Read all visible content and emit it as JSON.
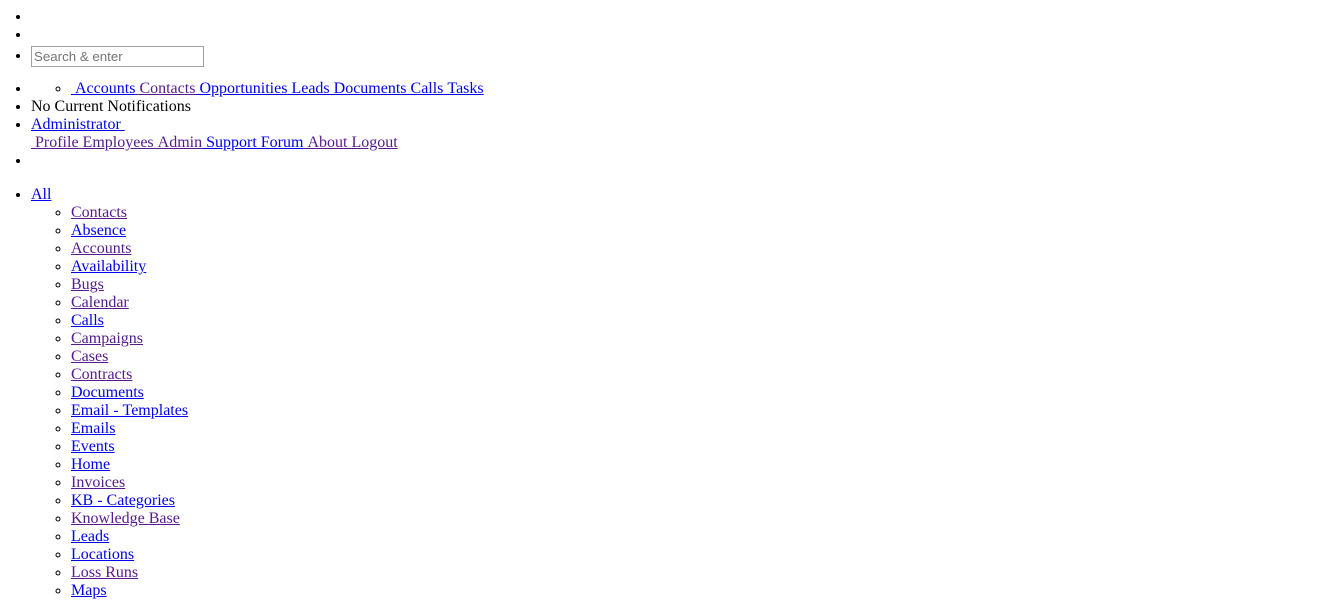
{
  "search": {
    "placeholder": "Search & enter",
    "value": ""
  },
  "quick_create": [
    {
      "label": " Accounts",
      "visited": false
    },
    {
      "label": " Contacts",
      "visited": true
    },
    {
      "label": " Opportunities",
      "visited": false
    },
    {
      "label": " Leads",
      "visited": false
    },
    {
      "label": " Documents",
      "visited": false
    },
    {
      "label": " Calls",
      "visited": false
    },
    {
      "label": " Tasks",
      "visited": false
    }
  ],
  "notifications": {
    "text": "No Current Notifications"
  },
  "user_menu": {
    "username": "Administrator ",
    "items": [
      {
        "label": " Profile",
        "visited": true
      },
      {
        "label": " Employees",
        "visited": true
      },
      {
        "label": " Admin",
        "visited": true
      },
      {
        "label": " Support Forum",
        "visited": false
      },
      {
        "label": " About",
        "visited": true
      },
      {
        "label": " Logout",
        "visited": true
      }
    ]
  },
  "modules": {
    "all_label": "All",
    "items": [
      {
        "label": "Contacts",
        "visited": true
      },
      {
        "label": "Absence",
        "visited": false
      },
      {
        "label": "Accounts",
        "visited": true
      },
      {
        "label": "Availability",
        "visited": false
      },
      {
        "label": "Bugs",
        "visited": true
      },
      {
        "label": "Calendar",
        "visited": true
      },
      {
        "label": "Calls",
        "visited": false
      },
      {
        "label": "Campaigns",
        "visited": true
      },
      {
        "label": "Cases",
        "visited": true
      },
      {
        "label": "Contracts",
        "visited": true
      },
      {
        "label": "Documents",
        "visited": false
      },
      {
        "label": "Email - Templates",
        "visited": false
      },
      {
        "label": "Emails",
        "visited": false
      },
      {
        "label": "Events",
        "visited": false
      },
      {
        "label": "Home",
        "visited": false
      },
      {
        "label": "Invoices",
        "visited": true
      },
      {
        "label": "KB - Categories",
        "visited": false
      },
      {
        "label": "Knowledge Base",
        "visited": true
      },
      {
        "label": "Leads",
        "visited": false
      },
      {
        "label": "Locations",
        "visited": false
      },
      {
        "label": "Loss Runs",
        "visited": true
      },
      {
        "label": "Maps",
        "visited": false
      }
    ]
  },
  "colors": {
    "link": "#0000ee",
    "visited_link": "#551a8b"
  }
}
